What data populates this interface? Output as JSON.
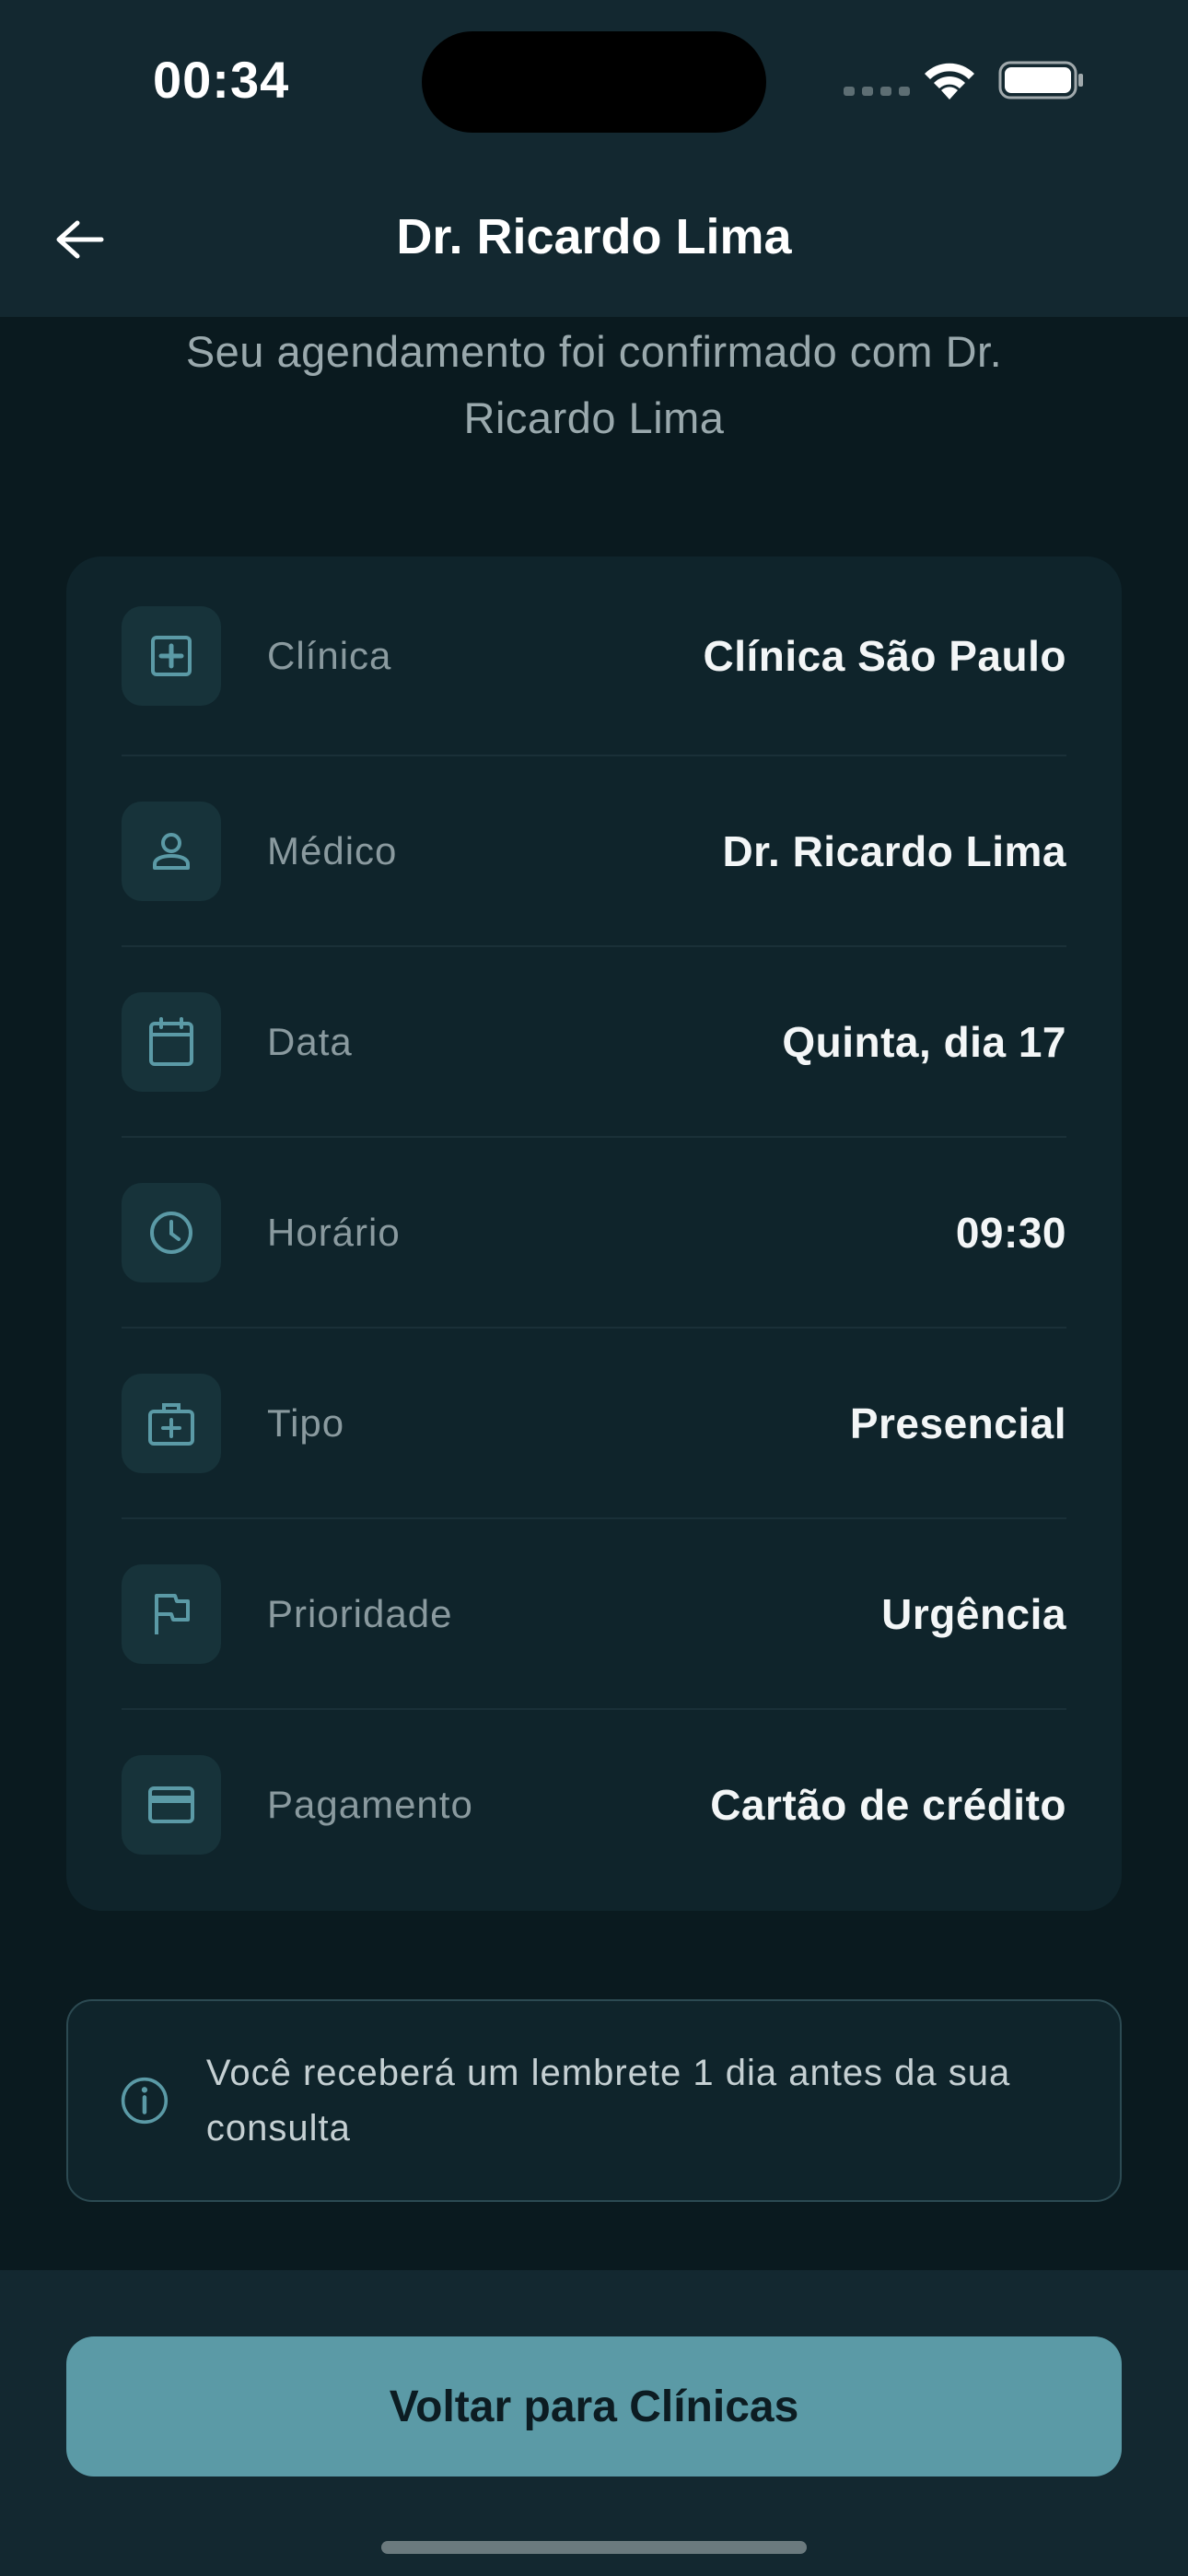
{
  "status_bar": {
    "time": "00:34"
  },
  "header": {
    "title": "Dr. Ricardo Lima",
    "back_icon": "arrow-left-icon"
  },
  "confirmation": {
    "message": "Seu agendamento foi confirmado com Dr. Ricardo Lima"
  },
  "details": [
    {
      "icon": "clinic-plus-icon",
      "label": "Clínica",
      "value": "Clínica São Paulo"
    },
    {
      "icon": "person-icon",
      "label": "Médico",
      "value": "Dr. Ricardo Lima"
    },
    {
      "icon": "calendar-icon",
      "label": "Data",
      "value": "Quinta, dia 17"
    },
    {
      "icon": "clock-icon",
      "label": "Horário",
      "value": "09:30"
    },
    {
      "icon": "medical-bag-icon",
      "label": "Tipo",
      "value": "Presencial"
    },
    {
      "icon": "flag-icon",
      "label": "Prioridade",
      "value": "Urgência"
    },
    {
      "icon": "credit-card-icon",
      "label": "Pagamento",
      "value": "Cartão de crédito"
    }
  ],
  "reminder": {
    "icon": "info-icon",
    "text": "Você receberá um lembrete 1 dia antes da sua consulta"
  },
  "actions": {
    "back_to_clinics": "Voltar para Clínicas"
  },
  "colors": {
    "background": "#0a1a1f",
    "card": "#0f242b",
    "accent": "#5b9aa6",
    "icon": "#5b9aa6"
  }
}
